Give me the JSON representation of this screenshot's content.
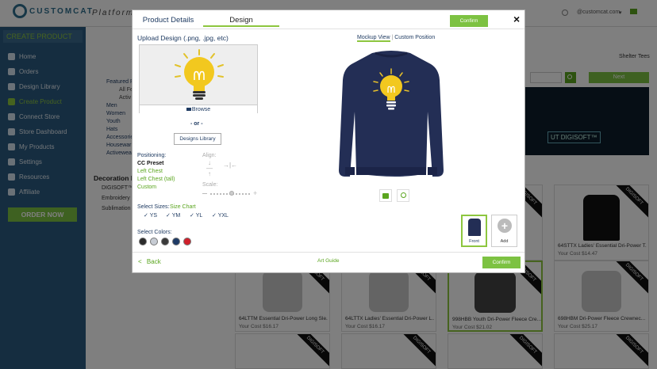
{
  "header": {
    "logo_text": "CUSTOMCAT",
    "platform_text": "Platform",
    "user_email": "@customcat.com",
    "user_caret": "▾"
  },
  "sidebar": {
    "create_product_btn": "CREATE PRODUCT",
    "items": [
      {
        "label": "Home",
        "active": false
      },
      {
        "label": "Orders",
        "active": false
      },
      {
        "label": "Design Library",
        "active": false
      },
      {
        "label": "Create Product",
        "active": true
      },
      {
        "label": "Connect Store",
        "active": false
      },
      {
        "label": "Store Dashboard",
        "active": false
      },
      {
        "label": "My Products",
        "active": false
      },
      {
        "label": "Settings",
        "active": false
      },
      {
        "label": "Resources",
        "active": false
      },
      {
        "label": "Affiliate",
        "active": false
      }
    ],
    "order_now": "ORDER NOW"
  },
  "background": {
    "store_name": "Shelter Tees",
    "next_button": "Next",
    "digisoft_text": "UT DIGISOFT™",
    "filters": {
      "featured": "Featured P",
      "all": "All Fe",
      "active": "Activ",
      "men": "Men",
      "women": "Women",
      "youth": "Youth",
      "hats": "Hats",
      "accessories": "Accessorie",
      "houseware": "Housewar",
      "activewear": "Activewea"
    },
    "decoration_title": "Decoration M",
    "decorations": [
      "DIGISOFT™ D",
      "Embroidery D",
      "Sublimation D"
    ],
    "badge": "DIGISOFT",
    "products": [
      {
        "name": "",
        "price": ""
      },
      {
        "name": "",
        "price": ""
      },
      {
        "name": "",
        "price": ""
      },
      {
        "name": "64STTX Ladies' Essential Dri-Power T...",
        "price": "Your Cost $14.47"
      },
      {
        "name": "64LTTM Essential Dri-Power Long Sle...",
        "price": "Your Cost $16.17"
      },
      {
        "name": "64LTTX Ladies' Essential Dri-Power L...",
        "price": "Your Cost $16.17"
      },
      {
        "name": "998HBB Youth Dri-Power Fleece Cre...",
        "price": "Your Cost $21.02"
      },
      {
        "name": "698HBM Dri-Power Fleece Crewnec...",
        "price": "Your Cost $25.17"
      }
    ]
  },
  "modal": {
    "tabs": [
      {
        "label": "Product Details",
        "active": false
      },
      {
        "label": "Design",
        "active": true
      }
    ],
    "confirm_top": "Confirm",
    "close": "×",
    "upload_title": "Upload Design",
    "upload_formats": "(.png, .jpg, etc)",
    "browse": "Browse",
    "or": "- or -",
    "designs_library": "Designs Library",
    "positioning_label": "Positioning:",
    "positions": [
      "CC Preset",
      "Left Chest",
      "Left Chest (tall)",
      "Custom"
    ],
    "align_label": "Align:",
    "scale_label": "Scale:",
    "select_sizes_label": "Select Sizes:",
    "size_chart": "Size Chart",
    "sizes": [
      "YS",
      "YM",
      "YL",
      "YXL"
    ],
    "select_colors_label": "Select Colors:",
    "colors": [
      "#2b2b2b",
      "#c7ccd4",
      "#3a3a3a",
      "#1e3b66",
      "#d01f2b"
    ],
    "mockup_view": "Mockup View",
    "custom_position": "Custom Position",
    "view_separator": "|",
    "front_label": "Front",
    "add_label": "Add",
    "back": "Back",
    "back_arrow": "<",
    "art_guide": "Art Guide",
    "confirm_bottom": "Confirm"
  }
}
